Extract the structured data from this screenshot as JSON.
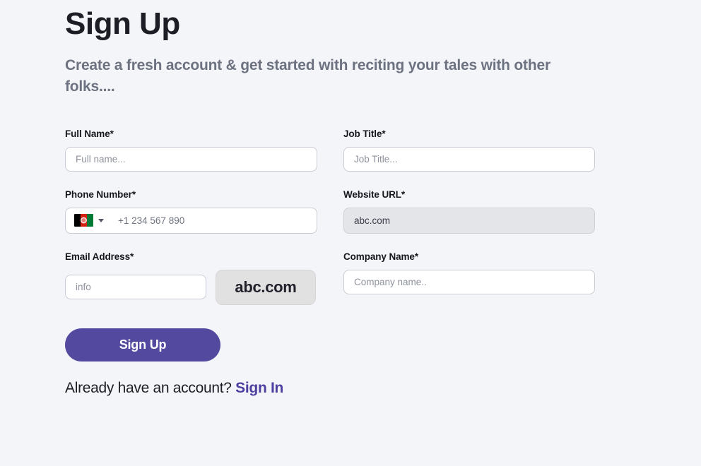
{
  "header": {
    "title": "Sign Up",
    "subtitle": "Create a fresh account & get started with reciting your tales with other folks...."
  },
  "form": {
    "full_name": {
      "label": "Full Name",
      "required_mark": "*",
      "placeholder": "Full name...",
      "value": ""
    },
    "job_title": {
      "label": "Job Title",
      "required_mark": "*",
      "placeholder": "Job Title...",
      "value": ""
    },
    "phone_number": {
      "label": "Phone Number",
      "required_mark": "*",
      "placeholder": "+1 234 567 890",
      "value": "",
      "country_flag": "afghanistan-flag-icon",
      "dropdown_icon": "chevron-down-icon"
    },
    "website_url": {
      "label": "Website URL",
      "required_mark": "*",
      "value": "abc.com",
      "disabled": true
    },
    "email_address": {
      "label": "Email Address",
      "required_mark": "*",
      "placeholder": "info",
      "value": "",
      "domain_suffix": "abc.com"
    },
    "company_name": {
      "label": "Company Name",
      "required_mark": "*",
      "placeholder": "Company name..",
      "value": ""
    }
  },
  "footer": {
    "submit_label": "Sign Up",
    "account_prompt": "Already have an account? ",
    "signin_label": "Sign In"
  },
  "colors": {
    "background": "#f4f5f9",
    "accent": "#534aa0",
    "link": "#4c3fa0",
    "label_text": "#16161d",
    "subtitle_text": "#6d7280",
    "input_border": "#c9ccd4",
    "disabled_fill": "#e3e5e8",
    "chip_fill": "#e2e1e1"
  }
}
